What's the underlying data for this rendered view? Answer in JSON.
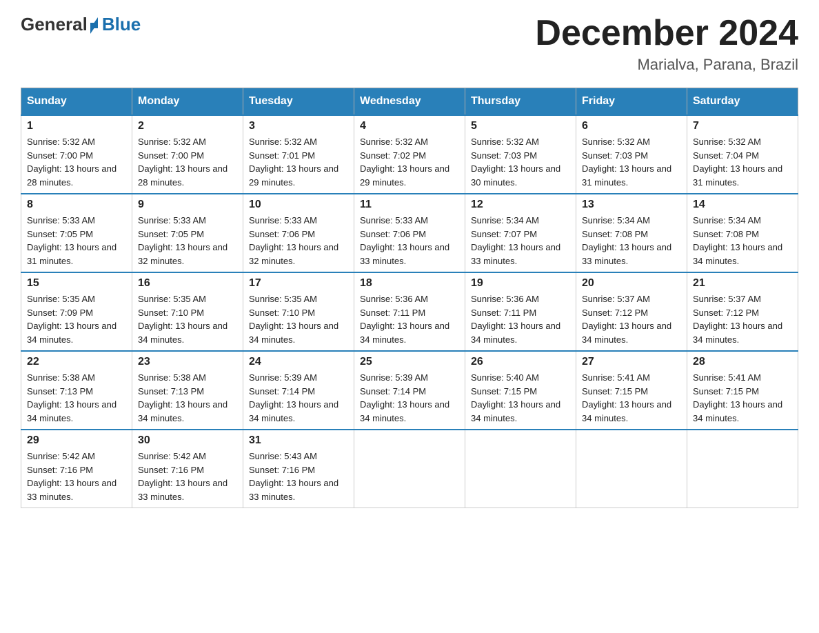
{
  "header": {
    "logo": {
      "general": "General",
      "blue": "Blue"
    },
    "title": "December 2024",
    "location": "Marialva, Parana, Brazil"
  },
  "weekdays": [
    "Sunday",
    "Monday",
    "Tuesday",
    "Wednesday",
    "Thursday",
    "Friday",
    "Saturday"
  ],
  "weeks": [
    [
      {
        "day": "1",
        "sunrise": "5:32 AM",
        "sunset": "7:00 PM",
        "daylight": "13 hours and 28 minutes."
      },
      {
        "day": "2",
        "sunrise": "5:32 AM",
        "sunset": "7:00 PM",
        "daylight": "13 hours and 28 minutes."
      },
      {
        "day": "3",
        "sunrise": "5:32 AM",
        "sunset": "7:01 PM",
        "daylight": "13 hours and 29 minutes."
      },
      {
        "day": "4",
        "sunrise": "5:32 AM",
        "sunset": "7:02 PM",
        "daylight": "13 hours and 29 minutes."
      },
      {
        "day": "5",
        "sunrise": "5:32 AM",
        "sunset": "7:03 PM",
        "daylight": "13 hours and 30 minutes."
      },
      {
        "day": "6",
        "sunrise": "5:32 AM",
        "sunset": "7:03 PM",
        "daylight": "13 hours and 31 minutes."
      },
      {
        "day": "7",
        "sunrise": "5:32 AM",
        "sunset": "7:04 PM",
        "daylight": "13 hours and 31 minutes."
      }
    ],
    [
      {
        "day": "8",
        "sunrise": "5:33 AM",
        "sunset": "7:05 PM",
        "daylight": "13 hours and 31 minutes."
      },
      {
        "day": "9",
        "sunrise": "5:33 AM",
        "sunset": "7:05 PM",
        "daylight": "13 hours and 32 minutes."
      },
      {
        "day": "10",
        "sunrise": "5:33 AM",
        "sunset": "7:06 PM",
        "daylight": "13 hours and 32 minutes."
      },
      {
        "day": "11",
        "sunrise": "5:33 AM",
        "sunset": "7:06 PM",
        "daylight": "13 hours and 33 minutes."
      },
      {
        "day": "12",
        "sunrise": "5:34 AM",
        "sunset": "7:07 PM",
        "daylight": "13 hours and 33 minutes."
      },
      {
        "day": "13",
        "sunrise": "5:34 AM",
        "sunset": "7:08 PM",
        "daylight": "13 hours and 33 minutes."
      },
      {
        "day": "14",
        "sunrise": "5:34 AM",
        "sunset": "7:08 PM",
        "daylight": "13 hours and 34 minutes."
      }
    ],
    [
      {
        "day": "15",
        "sunrise": "5:35 AM",
        "sunset": "7:09 PM",
        "daylight": "13 hours and 34 minutes."
      },
      {
        "day": "16",
        "sunrise": "5:35 AM",
        "sunset": "7:10 PM",
        "daylight": "13 hours and 34 minutes."
      },
      {
        "day": "17",
        "sunrise": "5:35 AM",
        "sunset": "7:10 PM",
        "daylight": "13 hours and 34 minutes."
      },
      {
        "day": "18",
        "sunrise": "5:36 AM",
        "sunset": "7:11 PM",
        "daylight": "13 hours and 34 minutes."
      },
      {
        "day": "19",
        "sunrise": "5:36 AM",
        "sunset": "7:11 PM",
        "daylight": "13 hours and 34 minutes."
      },
      {
        "day": "20",
        "sunrise": "5:37 AM",
        "sunset": "7:12 PM",
        "daylight": "13 hours and 34 minutes."
      },
      {
        "day": "21",
        "sunrise": "5:37 AM",
        "sunset": "7:12 PM",
        "daylight": "13 hours and 34 minutes."
      }
    ],
    [
      {
        "day": "22",
        "sunrise": "5:38 AM",
        "sunset": "7:13 PM",
        "daylight": "13 hours and 34 minutes."
      },
      {
        "day": "23",
        "sunrise": "5:38 AM",
        "sunset": "7:13 PM",
        "daylight": "13 hours and 34 minutes."
      },
      {
        "day": "24",
        "sunrise": "5:39 AM",
        "sunset": "7:14 PM",
        "daylight": "13 hours and 34 minutes."
      },
      {
        "day": "25",
        "sunrise": "5:39 AM",
        "sunset": "7:14 PM",
        "daylight": "13 hours and 34 minutes."
      },
      {
        "day": "26",
        "sunrise": "5:40 AM",
        "sunset": "7:15 PM",
        "daylight": "13 hours and 34 minutes."
      },
      {
        "day": "27",
        "sunrise": "5:41 AM",
        "sunset": "7:15 PM",
        "daylight": "13 hours and 34 minutes."
      },
      {
        "day": "28",
        "sunrise": "5:41 AM",
        "sunset": "7:15 PM",
        "daylight": "13 hours and 34 minutes."
      }
    ],
    [
      {
        "day": "29",
        "sunrise": "5:42 AM",
        "sunset": "7:16 PM",
        "daylight": "13 hours and 33 minutes."
      },
      {
        "day": "30",
        "sunrise": "5:42 AM",
        "sunset": "7:16 PM",
        "daylight": "13 hours and 33 minutes."
      },
      {
        "day": "31",
        "sunrise": "5:43 AM",
        "sunset": "7:16 PM",
        "daylight": "13 hours and 33 minutes."
      },
      null,
      null,
      null,
      null
    ]
  ]
}
